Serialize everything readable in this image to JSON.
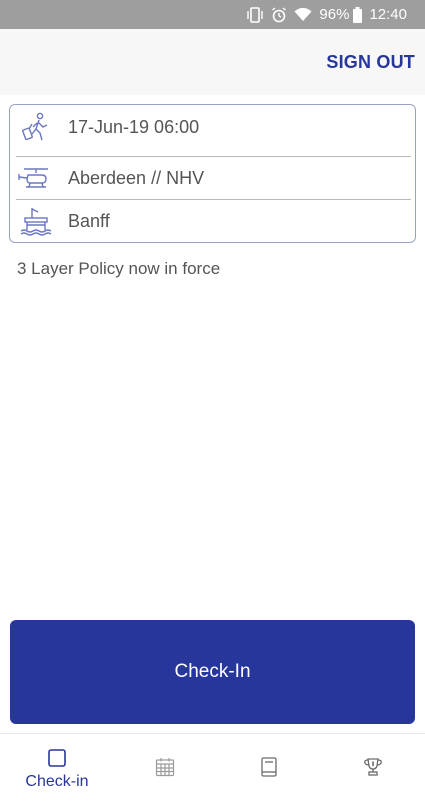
{
  "status_bar": {
    "battery": "96%",
    "time": "12:40"
  },
  "header": {
    "sign_out_label": "SIGN OUT"
  },
  "trip": {
    "datetime": "17-Jun-19 06:00",
    "route": "Aberdeen // NHV",
    "destination": "Banff"
  },
  "notice": "3 Layer Policy now in force",
  "checkin_button_label": "Check-In",
  "bottom_nav": {
    "items": [
      {
        "label": "Check-in",
        "icon": "checkbox-square-icon",
        "active": true
      },
      {
        "label": "",
        "icon": "calendar-icon",
        "active": false
      },
      {
        "label": "",
        "icon": "book-icon",
        "active": false
      },
      {
        "label": "",
        "icon": "trophy-icon",
        "active": false
      }
    ]
  },
  "colors": {
    "accent": "#27369a",
    "status_bar": "#9e9e9e",
    "icon_line": "#6b76c4",
    "inactive_icon": "#9a9a9a"
  }
}
